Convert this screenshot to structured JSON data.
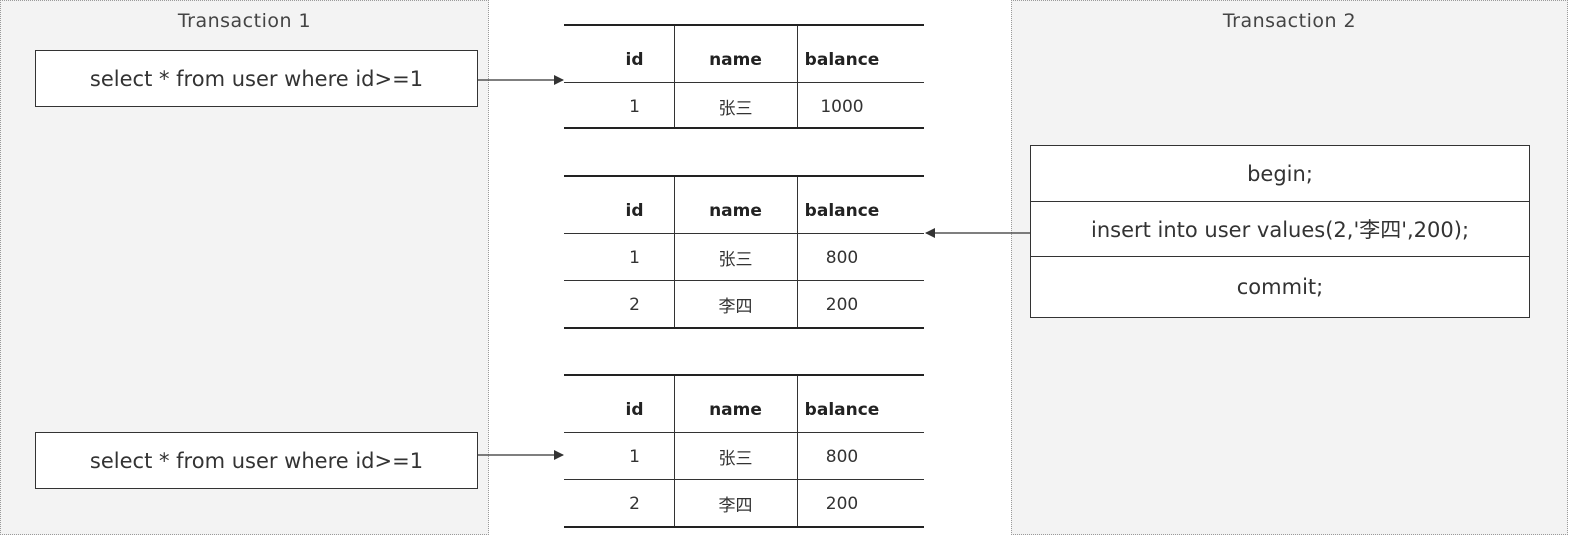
{
  "transaction1": {
    "title": "Transaction  1",
    "query_top": "select * from user where id>=1",
    "query_bottom": "select * from user where id>=1"
  },
  "transaction2": {
    "title": "Transaction  2",
    "steps": [
      "begin;",
      "insert into user values(2,'李四',200);",
      "commit;"
    ]
  },
  "tables": [
    {
      "headers": [
        "id",
        "name",
        "balance"
      ],
      "rows": [
        [
          "1",
          "张三",
          "1000"
        ]
      ]
    },
    {
      "headers": [
        "id",
        "name",
        "balance"
      ],
      "rows": [
        [
          "1",
          "张三",
          "800"
        ],
        [
          "2",
          "李四",
          "200"
        ]
      ]
    },
    {
      "headers": [
        "id",
        "name",
        "balance"
      ],
      "rows": [
        [
          "1",
          "张三",
          "800"
        ],
        [
          "2",
          "李四",
          "200"
        ]
      ]
    }
  ]
}
